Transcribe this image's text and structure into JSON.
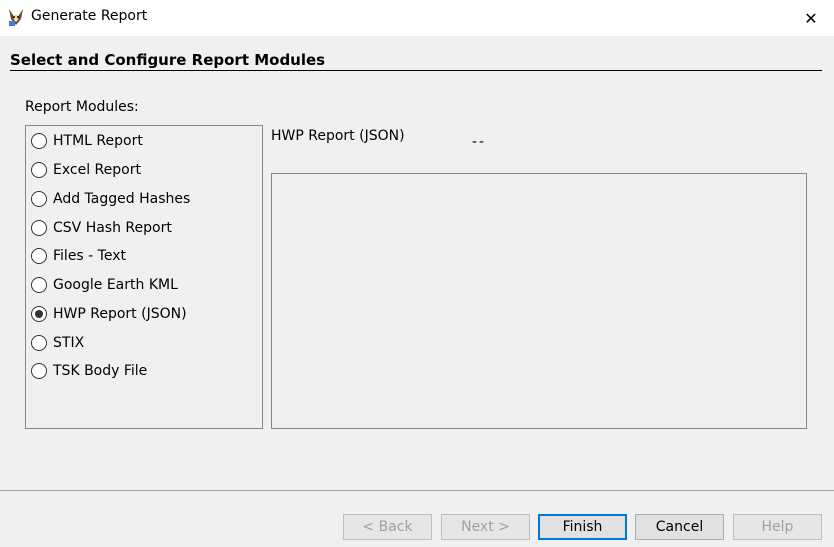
{
  "window": {
    "title": "Generate Report",
    "close_icon": "✕"
  },
  "page": {
    "section_header": "Select and Configure Report Modules",
    "modules_label": "Report Modules:"
  },
  "modules": [
    {
      "label": "HTML Report",
      "selected": false
    },
    {
      "label": "Excel Report",
      "selected": false
    },
    {
      "label": "Add Tagged Hashes",
      "selected": false
    },
    {
      "label": "CSV Hash Report",
      "selected": false
    },
    {
      "label": "Files - Text",
      "selected": false
    },
    {
      "label": "Google Earth KML",
      "selected": false
    },
    {
      "label": "HWP Report (JSON)",
      "selected": true
    },
    {
      "label": "STIX",
      "selected": false
    },
    {
      "label": "TSK Body File",
      "selected": false
    }
  ],
  "selected_module": {
    "name": "HWP Report (JSON)",
    "description": "--"
  },
  "buttons": {
    "back": "< Back",
    "next": "Next >",
    "finish": "Finish",
    "cancel": "Cancel",
    "help": "Help"
  },
  "icons": {
    "app": "autopsy-dog-icon",
    "close": "close-icon"
  },
  "colors": {
    "accent": "#0078d7"
  }
}
